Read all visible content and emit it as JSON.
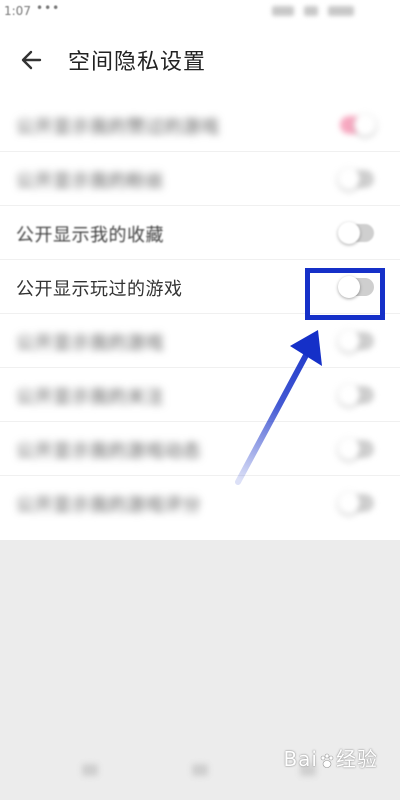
{
  "status_bar": {
    "time": "1:07",
    "dots": "•••"
  },
  "header": {
    "title": "空间隐私设置",
    "back_icon": "arrow-left-icon"
  },
  "settings": [
    {
      "label": "公开显示我的赞过的游戏",
      "toggle_on": true,
      "blurred": true
    },
    {
      "label": "公开显示我的粉丝",
      "toggle_on": false,
      "blurred": true
    },
    {
      "label": "公开显示我的收藏",
      "toggle_on": false,
      "blurred": false
    },
    {
      "label": "公开显示玩过的游戏",
      "toggle_on": false,
      "blurred": false
    },
    {
      "label": "公开显示我的游戏",
      "toggle_on": false,
      "blurred": true
    },
    {
      "label": "公开显示我的关注",
      "toggle_on": false,
      "blurred": true
    },
    {
      "label": "公开显示我的游戏动态",
      "toggle_on": false,
      "blurred": true
    },
    {
      "label": "公开显示我的游戏评分",
      "toggle_on": false,
      "blurred": true
    }
  ],
  "annotation": {
    "highlight_color": "#1530c8",
    "highlighted_row": "公开显示玩过的游戏"
  },
  "watermark": {
    "text_left": "Bai",
    "text_right": "经验"
  },
  "colors": {
    "toggle_on": "#f7a8c0",
    "toggle_off": "#cfcfcf",
    "accent": "#1530c8"
  }
}
